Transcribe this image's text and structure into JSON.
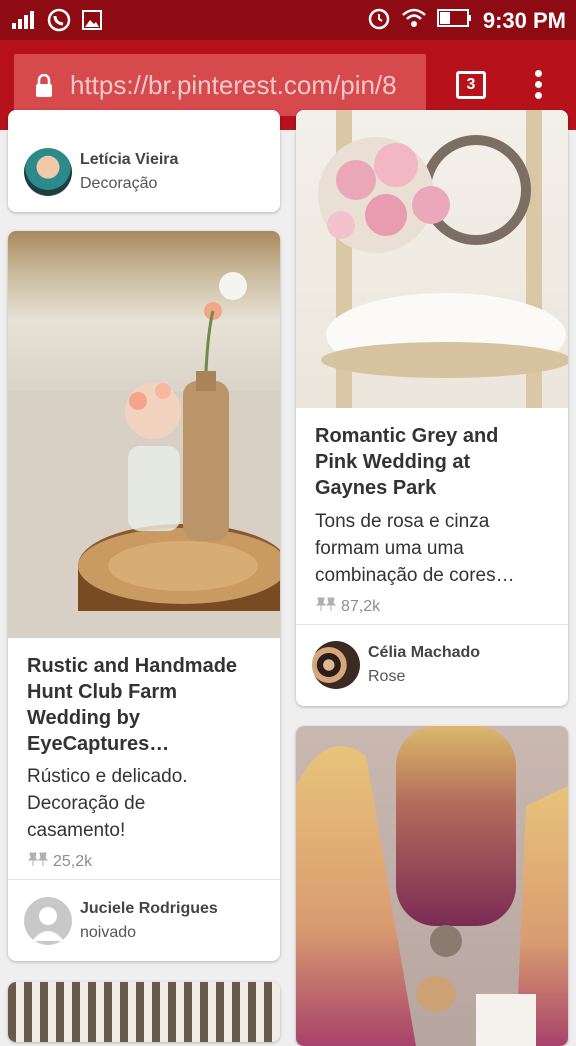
{
  "status_bar": {
    "time": "9:30 PM",
    "icons": [
      "signal-icon",
      "whatsapp-icon",
      "gallery-icon",
      "alarm-icon",
      "wifi-icon",
      "battery-icon"
    ]
  },
  "browser": {
    "url": "https://br.pinterest.com/pin/8",
    "tab_count": "3",
    "colors": {
      "status": "#8f0b13",
      "toolbar": "#b7121b",
      "urlfield": "#d64a4e"
    }
  },
  "pins": {
    "top_left": {
      "user": "Letícia Vieira",
      "board": "Decoração"
    },
    "left_rustic": {
      "title": "Rustic and Handmade Hunt Club Farm Wedding by EyeCaptures…",
      "title_lines": [
        "Rustic and Handmade",
        "Hunt Club Farm",
        "Wedding by",
        "EyeCaptures…"
      ],
      "description_lines": [
        "Rústico e delicado.",
        "Decoração de",
        "casamento!"
      ],
      "saves": "25,2k",
      "user": "Juciele Rodrigues",
      "board": "noivado"
    },
    "right_romantic": {
      "title_lines": [
        "Romantic Grey and",
        "Pink Wedding at",
        "Gaynes Park"
      ],
      "description_lines": [
        "Tons de rosa e cinza",
        "formam uma uma",
        "combinação de cores…"
      ],
      "saves": "87,2k",
      "user": "Célia Machado",
      "board": "Rose"
    }
  }
}
